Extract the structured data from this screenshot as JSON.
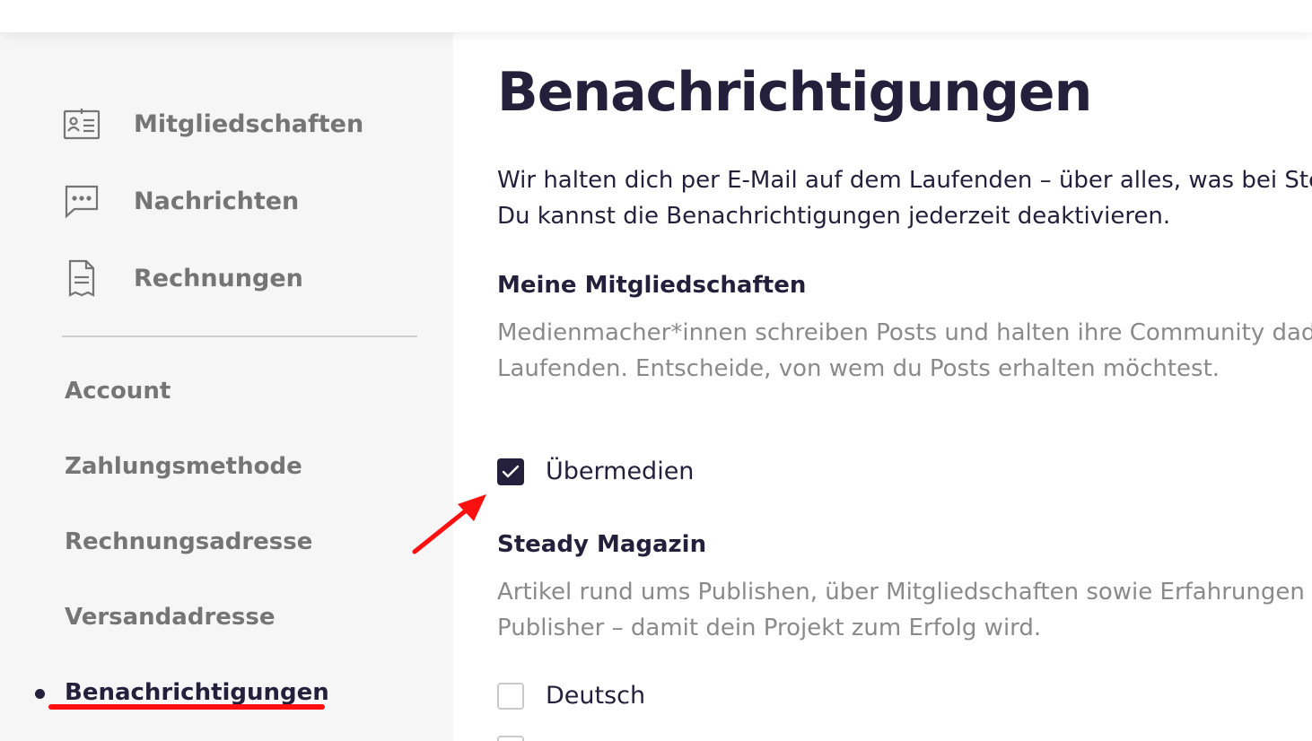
{
  "sidebar": {
    "menu": [
      {
        "label": "Mitgliedschaften",
        "icon": "membership-card-icon"
      },
      {
        "label": "Nachrichten",
        "icon": "chat-bubble-icon"
      },
      {
        "label": "Rechnungen",
        "icon": "invoice-document-icon"
      }
    ],
    "settings": [
      {
        "label": "Account"
      },
      {
        "label": "Zahlungsmethode"
      },
      {
        "label": "Rechnungsadresse"
      },
      {
        "label": "Versandadresse"
      },
      {
        "label": "Benachrichtigungen",
        "active": true
      }
    ]
  },
  "main": {
    "title": "Benachrichtigungen",
    "intro": "Wir halten dich per E-Mail auf dem Laufenden – über alles, was bei Steady passiert. Du kannst die Benachrichtigungen jederzeit deaktivieren.",
    "sections": [
      {
        "title": "Meine Mitgliedschaften",
        "description": "Medienmacher*innen schreiben Posts und halten ihre Community dadurch auf dem Laufenden. Entscheide, von wem du Posts erhalten möchtest.",
        "options": [
          {
            "label": "Übermedien",
            "checked": true
          }
        ]
      },
      {
        "title": "Steady Magazin",
        "description": "Artikel rund ums Publishen, über Mitgliedschaften sowie Erfahrungen anderer Publisher – damit dein Projekt zum Erfolg wird.",
        "options": [
          {
            "label": "Deutsch",
            "checked": false
          }
        ]
      }
    ]
  },
  "colors": {
    "accent": "#241f3a",
    "muted_text": "#757575",
    "description_text": "#8a8a8a",
    "sidebar_bg": "#f6f6f6",
    "annotation": "#ff1010"
  }
}
